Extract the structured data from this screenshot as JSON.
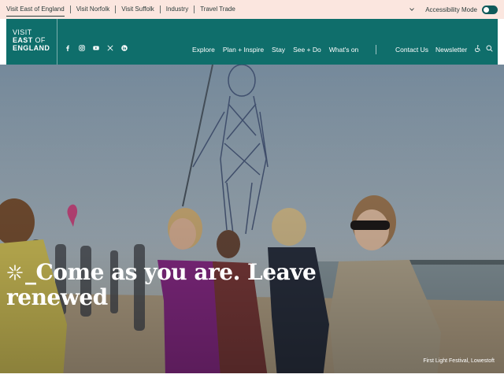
{
  "topbar": {
    "sites": [
      {
        "label": "Visit East of England"
      },
      {
        "label": "Visit Norfolk"
      },
      {
        "label": "Visit Suffolk"
      },
      {
        "label": "Industry"
      },
      {
        "label": "Travel Trade"
      }
    ],
    "accessibility_label": "Accessibility Mode"
  },
  "nav": {
    "logo": {
      "line1": "VISIT",
      "line2_bold": "EAST",
      "line2_rest": " OF",
      "line3": "ENGLAND"
    },
    "social_icons": [
      "facebook-icon",
      "instagram-icon",
      "youtube-icon",
      "x-icon",
      "linkedin-icon"
    ],
    "menu": [
      "Explore",
      "Plan + Inspire",
      "Stay",
      "See + Do",
      "What's on"
    ],
    "secondary": [
      "Contact Us",
      "Newsletter"
    ]
  },
  "hero": {
    "headline": "_Come as you are. Leave renewed",
    "caption": "First Light Festival, Lowestoft"
  },
  "colors": {
    "topbar_bg": "#fbe6df",
    "nav_bg": "#0f6e6b",
    "toggle": "#0f5a5a"
  }
}
